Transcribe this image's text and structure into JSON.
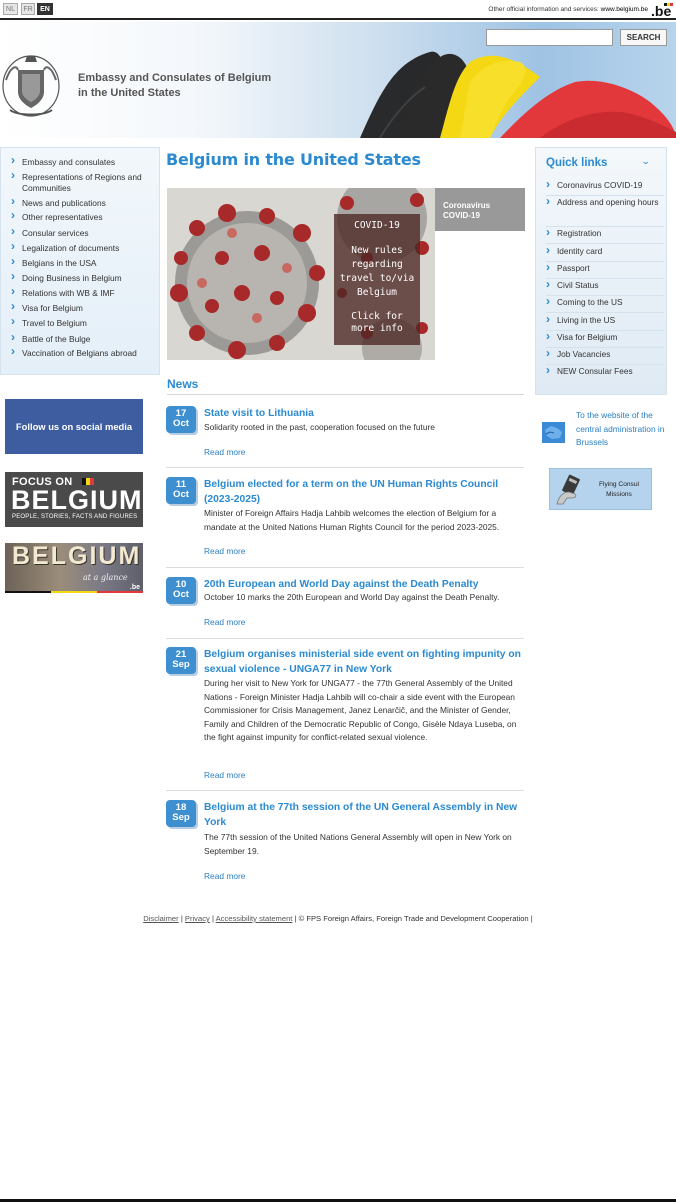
{
  "languages": [
    "NL",
    "FR",
    "EN"
  ],
  "language_active": "EN",
  "other_info": {
    "label": "Other official information and services:",
    "link": "www.belgium.be",
    "logo_text": ".be"
  },
  "header": {
    "title_line1": "Embassy and Consulates of Belgium",
    "title_line2": "in the United States",
    "search_placeholder": "",
    "search_button": "SEARCH"
  },
  "left_nav": [
    "Embassy and consulates",
    "Representations of Regions and Communities",
    "News and publications",
    "Other representatives",
    "Consular services",
    "Legalization of documents",
    "Belgians in the USA",
    "Doing Business in Belgium",
    "Relations with WB & IMF",
    "Visa for Belgium",
    "Travel to Belgium",
    "Battle of the Bulge",
    "Vaccination of Belgians abroad"
  ],
  "banners": {
    "social": "Follow us on social media",
    "focus_on": "FOCUS ON",
    "focus_big": "BELGIUM",
    "focus_sub": "PEOPLE, STORIES, FACTS AND FIGURES",
    "glance_big": "BELGIUM",
    "glance_sub": "at a glance",
    "glance_be": ".be"
  },
  "main": {
    "title": "Belgium in the United States",
    "covid": {
      "box_title": "COVID-19",
      "box_text": "New rules regarding travel to/via Belgium",
      "box_more": "Click for more info",
      "tab_line1": "Coronavirus",
      "tab_line2": "COVID-19"
    },
    "news_heading": "News",
    "read_more": "Read more",
    "news": [
      {
        "day": "17",
        "month": "Oct",
        "title": "State visit to Lithuania",
        "text": "Solidarity rooted in the past, cooperation focused on the future"
      },
      {
        "day": "11",
        "month": "Oct",
        "title": "Belgium elected for a term on the UN Human Rights Council (2023-2025)",
        "text": "Minister of Foreign Affairs Hadja Lahbib welcomes the election of Belgium for a mandate at the United Nations Human Rights Council for the period 2023-2025."
      },
      {
        "day": "10",
        "month": "Oct",
        "title": "20th European and World Day against the Death Penalty",
        "text": "October 10 marks the 20th European and World Day against the Death Penalty."
      },
      {
        "day": "21",
        "month": "Sep",
        "title": "Belgium organises ministerial side event on fighting impunity on sexual violence - UNGA77 in New York",
        "text": "During her visit to New York for UNGA77 - the 77th General Assembly of the United Nations - Foreign Minister Hadja Lahbib will co-chair a side event with the European Commissioner for Crisis Management, Janez Lenarčič, and the Minister of Gender, Family and Children of the Democratic Republic of Congo, Gisèle Ndaya Luseba, on the fight against impunity for conflict-related sexual violence."
      },
      {
        "day": "18",
        "month": "Sep",
        "title": "Belgium at the 77th session of the UN General Assembly in New York",
        "text": "The 77th session of the United Nations General Assembly will open in New York on September 19."
      }
    ]
  },
  "quick_links": {
    "title": "Quick links",
    "items": [
      "Coronavirus COVID-19",
      "Address and opening hours",
      "Registration",
      "Identity card",
      "Passport",
      "Civil Status",
      "Coming to the US",
      "Living in the US",
      "Visa for Belgium",
      "Job Vacancies",
      "NEW Consular Fees"
    ]
  },
  "right": {
    "central_link": "To the website of the central administration in Brussels",
    "flying_consul": "Flying Consul Missions"
  },
  "footer": {
    "disclaimer": "Disclaimer",
    "privacy": "Privacy",
    "accessibility": "Accessibility statement",
    "copyright": "© FPS Foreign Affairs, Foreign Trade and Development Cooperation"
  },
  "colors": {
    "accent": "#2b8ad0",
    "date_badge": "#3e8fd0",
    "flag_black": "#1a1a1a",
    "flag_yellow": "#f5d814",
    "flag_red": "#e2383c"
  }
}
